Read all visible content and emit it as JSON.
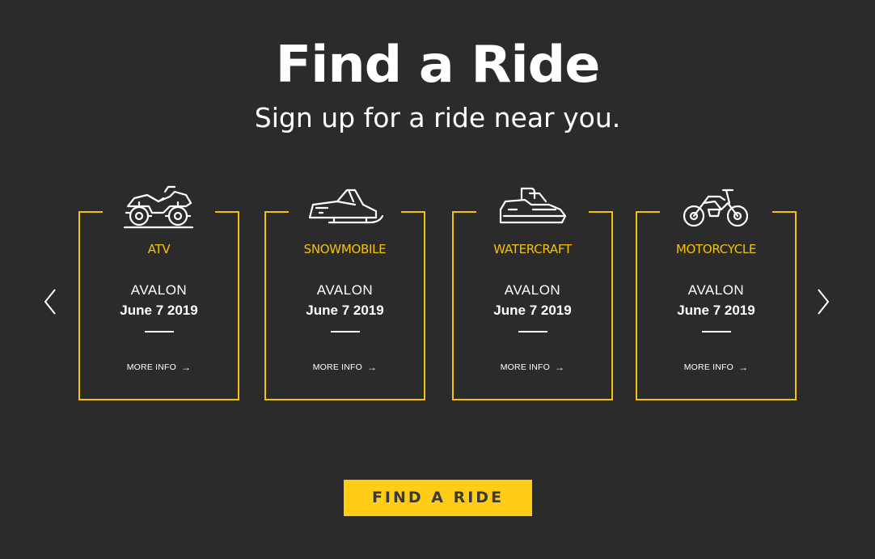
{
  "header": {
    "title": "Find a Ride",
    "subtitle": "Sign up for a ride near you."
  },
  "carousel": {
    "prev_icon": "chevron-left-icon",
    "next_icon": "chevron-right-icon",
    "cards": [
      {
        "category": "ATV",
        "location": "AVALON",
        "date": "June 7 2019",
        "link": "MORE INFO",
        "icon": "atv-icon"
      },
      {
        "category": "SNOWMOBILE",
        "location": "AVALON",
        "date": "June 7 2019",
        "link": "MORE INFO",
        "icon": "snowmobile-icon"
      },
      {
        "category": "WATERCRAFT",
        "location": "AVALON",
        "date": "June 7 2019",
        "link": "MORE INFO",
        "icon": "watercraft-icon"
      },
      {
        "category": "MOTORCYCLE",
        "location": "AVALON",
        "date": "June 7 2019",
        "link": "MORE INFO",
        "icon": "motorcycle-icon"
      }
    ]
  },
  "cta": {
    "label": "FIND A RIDE"
  },
  "colors": {
    "background": "#2b2b2b",
    "accent": "#f3c10e",
    "button": "#fecd14",
    "text": "#ffffff"
  }
}
